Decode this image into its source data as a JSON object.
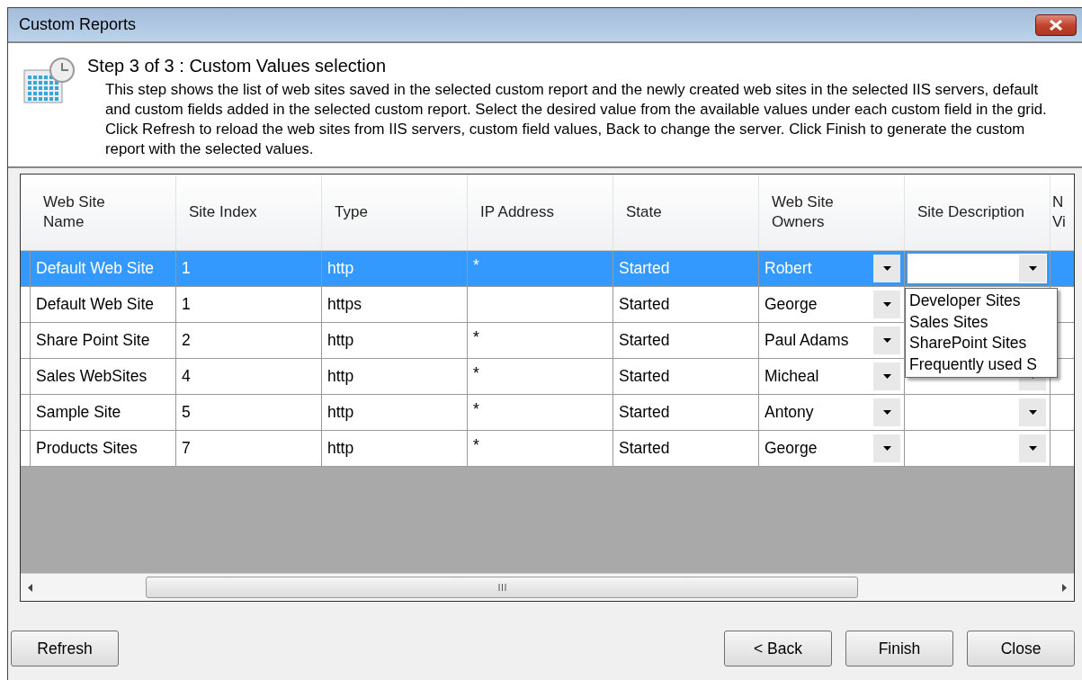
{
  "window": {
    "title": "Custom Reports"
  },
  "header": {
    "title": "Step 3 of 3 : Custom Values selection",
    "description": "This step shows the list of web sites saved in the selected custom report and the newly created web sites in the selected IIS servers, default and custom fields added in the selected custom report. Select the desired value from the available values under each custom field in the grid. Click Refresh to reload the web sites from IIS servers, custom field values, Back to change the server. Click Finish to generate the custom report with the selected values."
  },
  "grid": {
    "columns": [
      {
        "label": "Web Site\nName",
        "kind": "text"
      },
      {
        "label": "Site Index",
        "kind": "text"
      },
      {
        "label": "Type",
        "kind": "text"
      },
      {
        "label": "IP Address",
        "kind": "text"
      },
      {
        "label": "State",
        "kind": "text"
      },
      {
        "label": "Web Site\nOwners",
        "kind": "combo"
      },
      {
        "label": "Site Description",
        "kind": "combo"
      },
      {
        "label": "N\nVi",
        "kind": "text"
      }
    ],
    "rows": [
      {
        "selected": true,
        "cells": [
          "Default Web Site",
          "1",
          "http",
          "*",
          "Started",
          "Robert"
        ]
      },
      {
        "selected": false,
        "cells": [
          "Default Web Site",
          "1",
          "https",
          null,
          "Started",
          "George"
        ]
      },
      {
        "selected": false,
        "cells": [
          "Share Point Site",
          "2",
          "http",
          "*",
          "Started",
          "Paul Adams"
        ]
      },
      {
        "selected": false,
        "cells": [
          "Sales WebSites",
          "4",
          "http",
          "*",
          "Started",
          "Micheal"
        ]
      },
      {
        "selected": false,
        "cells": [
          "Sample Site",
          "5",
          "http",
          "*",
          "Started",
          "Antony"
        ]
      },
      {
        "selected": false,
        "cells": [
          "Products Sites",
          "7",
          "http",
          "*",
          "Started",
          "George"
        ]
      }
    ],
    "open_dropdown": {
      "options": [
        "Developer Sites",
        "Sales Sites",
        "SharePoint Sites",
        "Frequently used S"
      ]
    }
  },
  "buttons": [
    {
      "label": "Refresh",
      "kind": "left"
    },
    {
      "label": "< Back",
      "kind": "right"
    },
    {
      "label": "Finish",
      "kind": "right"
    },
    {
      "label": "Close",
      "kind": "right"
    }
  ]
}
